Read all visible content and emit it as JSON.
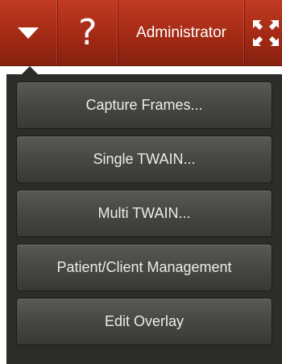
{
  "header": {
    "dropdown_icon": "caret-down-icon",
    "help_label": "?",
    "user_label": "Administrator",
    "expand_icon": "expand-arrows-icon",
    "bar_color": "#a32a15"
  },
  "menu": {
    "items": [
      {
        "label": "Capture Frames..."
      },
      {
        "label": "Single TWAIN..."
      },
      {
        "label": "Multi TWAIN..."
      },
      {
        "label": "Patient/Client Management"
      },
      {
        "label": "Edit Overlay"
      }
    ],
    "panel_color": "#2e2c29",
    "button_color": "#4a4844"
  }
}
